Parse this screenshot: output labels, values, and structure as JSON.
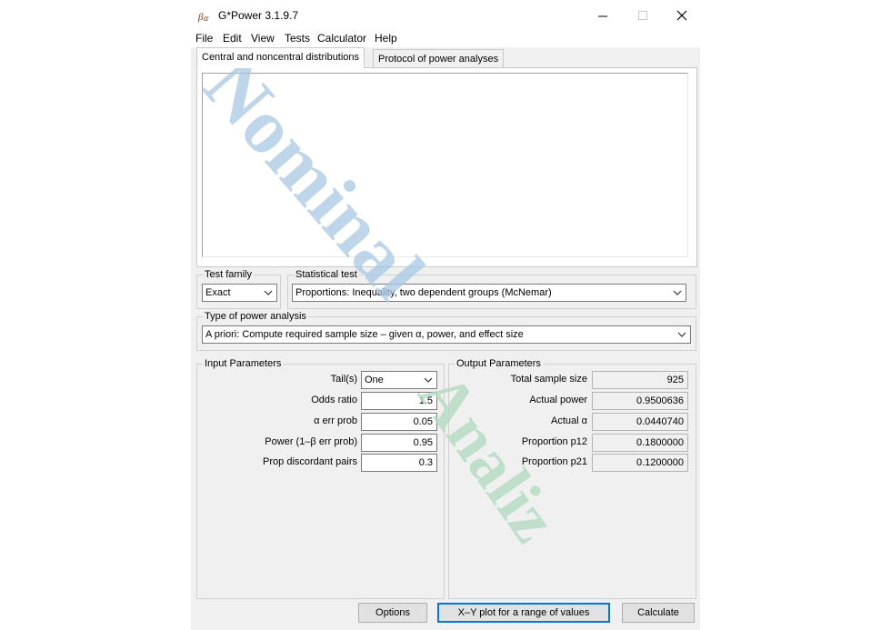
{
  "window": {
    "title": "G*Power 3.1.9.7",
    "icon": "gpower-app-icon",
    "controls": [
      "minimize-icon",
      "maximize-icon",
      "close-icon"
    ]
  },
  "menu": {
    "items": [
      "File",
      "Edit",
      "View",
      "Tests",
      "Calculator",
      "Help"
    ]
  },
  "tabs": [
    {
      "label": "Central and noncentral distributions",
      "active": true
    },
    {
      "label": "Protocol of power analyses",
      "active": false
    }
  ],
  "test_family": {
    "label": "Test family",
    "value": "Exact"
  },
  "statistical_test": {
    "label": "Statistical test",
    "value": "Proportions: Inequality, two dependent groups (McNemar)"
  },
  "power_analysis": {
    "label": "Type of power analysis",
    "value": "A priori: Compute required sample size – given α, power, and effect size"
  },
  "input": {
    "title": "Input Parameters",
    "params": [
      {
        "label": "Tail(s)",
        "value": "One",
        "kind": "combo"
      },
      {
        "label": "Odds ratio",
        "value": "1.5",
        "kind": "field"
      },
      {
        "label": "α err prob",
        "value": "0.05",
        "kind": "field"
      },
      {
        "label": "Power (1–β err prob)",
        "value": "0.95",
        "kind": "field"
      },
      {
        "label": "Prop discordant pairs",
        "value": "0.3",
        "kind": "field"
      }
    ]
  },
  "output": {
    "title": "Output Parameters",
    "params": [
      {
        "label": "Total sample size",
        "value": "925"
      },
      {
        "label": "Actual power",
        "value": "0.9500636"
      },
      {
        "label": "Actual α",
        "value": "0.0440740"
      },
      {
        "label": "Proportion p12",
        "value": "0.1800000"
      },
      {
        "label": "Proportion p21",
        "value": "0.1200000"
      }
    ]
  },
  "buttons": {
    "options": "Options",
    "xy_plot": "X–Y plot for a range of values",
    "calculate": "Calculate"
  },
  "watermark": {
    "line1": "Nominal",
    "line2": "Analiz",
    "color1": "#a9c8e4",
    "color2": "#b4dcc2"
  }
}
